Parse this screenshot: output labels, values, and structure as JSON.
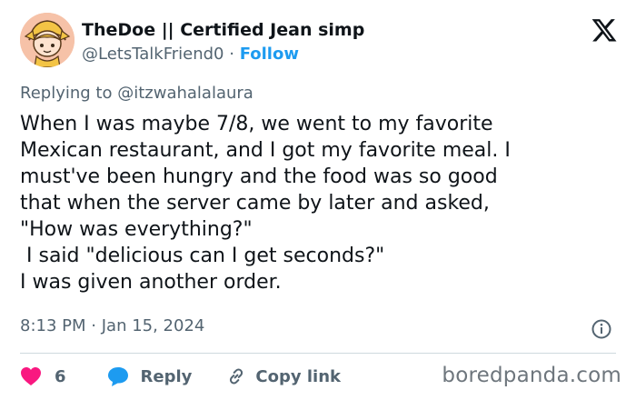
{
  "author": {
    "display_name": "TheDoe || Certified Jean simp",
    "handle": "@LetsTalkFriend0",
    "separator": "·",
    "follow_label": "Follow",
    "avatar_icon": "anime-character-avatar"
  },
  "platform_logo": "x-logo-icon",
  "reply_context": {
    "prefix": "Replying to",
    "mention": "@itzwahalalaura"
  },
  "tweet": {
    "text": "When I was maybe 7/8, we went to my favorite\nMexican restaurant, and I got my favorite meal. I\nmust've been hungry and the food was so good\nthat when the server came by later and asked,\n\"How was everything?\"\n I said \"delicious can I get seconds?\"\nI was given another order."
  },
  "meta": {
    "time": "8:13 PM",
    "separator": "·",
    "date": "Jan 15, 2024"
  },
  "actions": {
    "like_count": "6",
    "reply_label": "Reply",
    "copy_link_label": "Copy link"
  },
  "watermark": "boredpanda.com",
  "colors": {
    "like": "#f91880",
    "reply": "#1d9bf0",
    "link": "#1d9bf0",
    "muted": "#536471",
    "text": "#0f1419"
  }
}
